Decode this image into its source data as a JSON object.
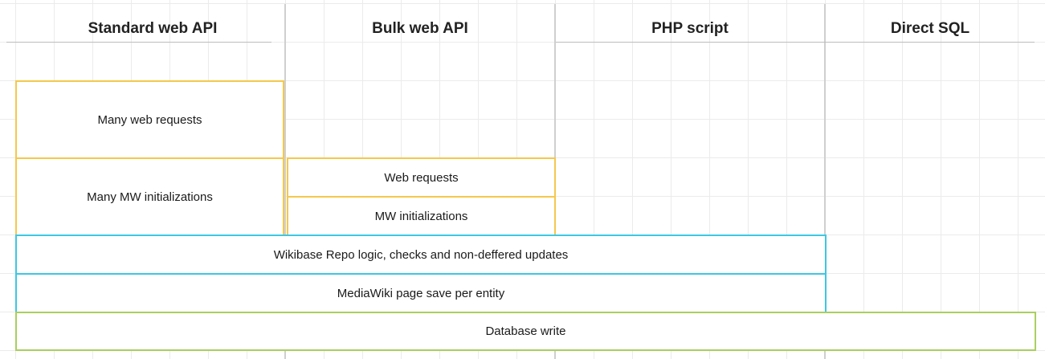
{
  "columns": [
    {
      "title": "Standard web API"
    },
    {
      "title": "Bulk web API"
    },
    {
      "title": "PHP script"
    },
    {
      "title": "Direct SQL"
    }
  ],
  "boxes": {
    "many_web_requests": "Many web requests",
    "many_mw_initializations": "Many MW initializations",
    "web_requests": "Web requests",
    "mw_initializations": "MW initializations",
    "wikibase_repo_logic": "Wikibase Repo logic, checks and non-deffered updates",
    "mediawiki_page_save": "MediaWiki page save per entity",
    "database_write": "Database write"
  },
  "colors": {
    "yellow_border": "#f5c84c",
    "cyan_border": "#3cc7e4",
    "green_border": "#a9cf5f",
    "grid": "#ebebeb",
    "divider": "#cfcfcf"
  }
}
